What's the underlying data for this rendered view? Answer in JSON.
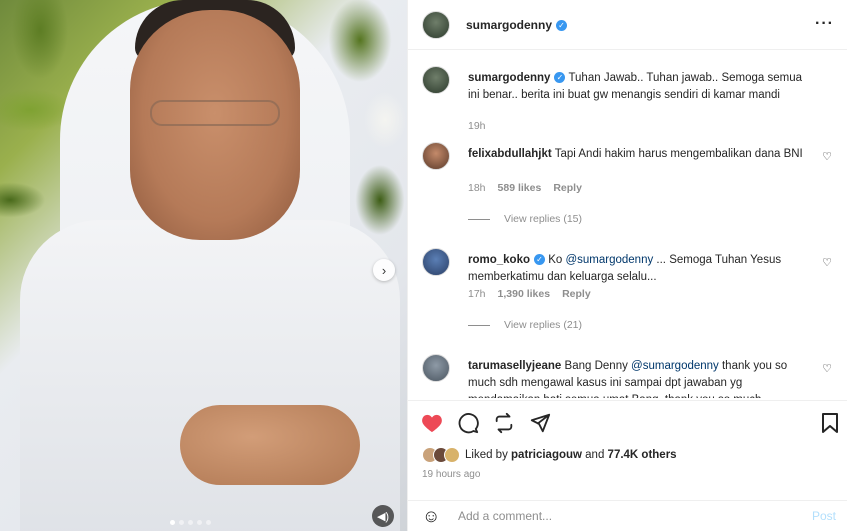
{
  "post": {
    "author": "sumargodenny",
    "more_icon": "more-horizontal-icon",
    "caption_author": "sumargodenny",
    "caption_text": "Tuhan Jawab.. Tuhan jawab.. Semoga semua ini benar.. berita ini buat gw menangis sendiri di kamar mandi",
    "caption_time": "19h"
  },
  "comments": [
    {
      "user": "felixabdullahjkt",
      "text": "Tapi Andi hakim harus mengembalikan dana BNI",
      "time": "18h",
      "likes": "589 likes",
      "reply": "Reply",
      "view_replies": "View replies (15)"
    },
    {
      "user": "romo_koko",
      "text_pre": "Ko ",
      "mention": "@sumargodenny",
      "text_post": " ... Semoga Tuhan Yesus memberkatimu dan keluarga selalu...",
      "time": "17h",
      "likes": "1,390 likes",
      "reply": "Reply",
      "view_replies": "View replies (21)"
    },
    {
      "user": "tarumasellyjeane",
      "text_pre": "Bang Denny ",
      "mention": "@sumargodenny",
      "text_post": " thank you so much sdh mengawal kasus ini sampai dpt jawaban yg mendamaikan hati semua umat Bang, thank you so much"
    }
  ],
  "likes_line": {
    "prefix": "Liked by ",
    "user": "patriciagouw",
    "mid": " and ",
    "others": "77.4K others"
  },
  "posted_ago": "19 hours ago",
  "add_comment": {
    "placeholder": "Add a comment...",
    "post_label": "Post"
  },
  "colors": {
    "like_red": "#ed4956",
    "verified_blue": "#3897f0",
    "mention": "#00376b"
  }
}
